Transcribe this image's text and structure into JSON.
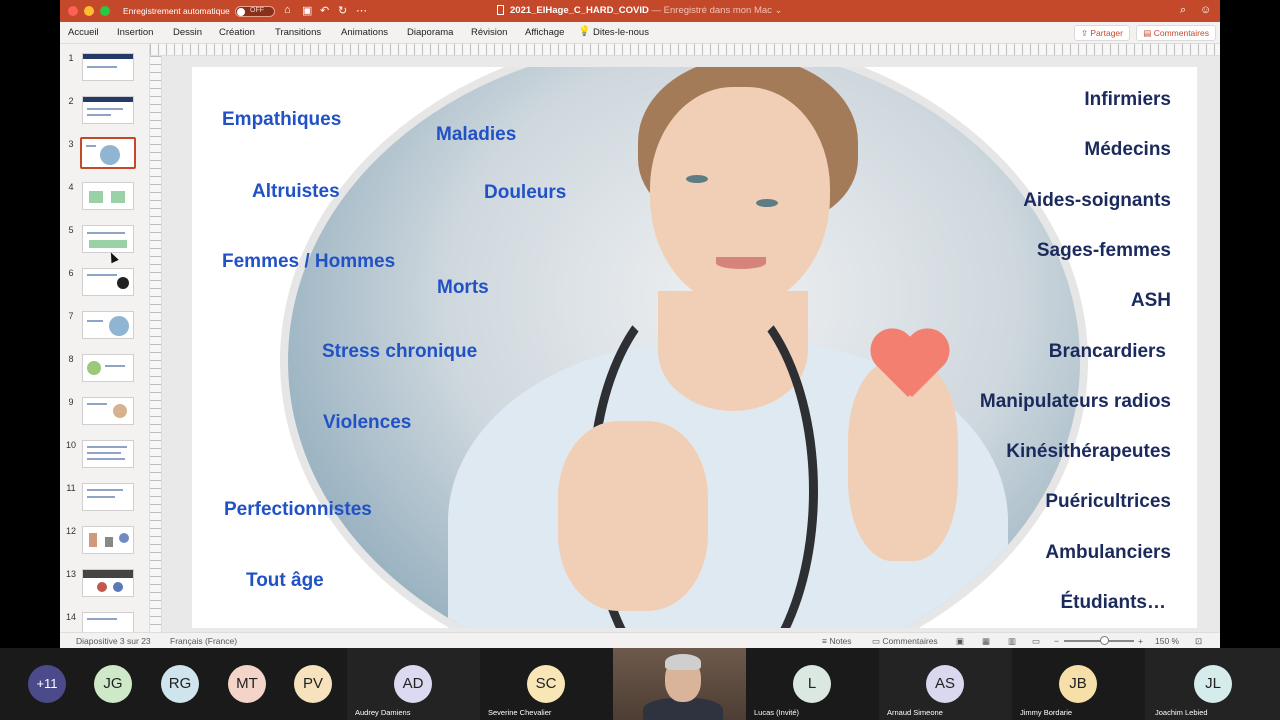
{
  "window": {
    "autosave_label": "Enregistrement automatique",
    "autosave_state": "OFF",
    "document_name": "2021_ElHage_C_HARD_COVID",
    "save_status": "— Enregistré dans mon Mac ⌄"
  },
  "ribbon": {
    "tabs": [
      "Accueil",
      "Insertion",
      "Dessin",
      "Création",
      "Transitions",
      "Animations",
      "Diaporama",
      "Révision",
      "Affichage"
    ],
    "tell_me": "Dites-le-nous",
    "share": "Partager",
    "comments": "Commentaires"
  },
  "thumbnails": {
    "numbers": [
      "1",
      "2",
      "3",
      "4",
      "5",
      "6",
      "7",
      "8",
      "9",
      "10",
      "11",
      "12",
      "13",
      "14"
    ],
    "active_index": 3
  },
  "slide": {
    "left_words": [
      "Empathiques",
      "Maladies",
      "Altruistes",
      "Douleurs",
      "Femmes / Hommes",
      "Morts",
      "Stress chronique",
      "Violences",
      "Perfectionnistes",
      "Tout âge"
    ],
    "right_words": [
      "Infirmiers",
      "Médecins",
      "Aides-soignants",
      "Sages-femmes",
      "ASH",
      "Brancardiers",
      "Manipulateurs radios",
      "Kinésithérapeutes",
      "Puéricultrices",
      "Ambulanciers",
      "Étudiants…"
    ],
    "colors": {
      "left": "#2152c5",
      "right": "#1b2a5c",
      "heart": "#f27f6f"
    }
  },
  "statusbar": {
    "slide_position": "Diapositive 3 sur 23",
    "language": "Français (France)",
    "notes": "Notes",
    "comments": "Commentaires",
    "zoom": "150 %"
  },
  "meeting": {
    "more_count": "+11",
    "participants": [
      {
        "initials": "JG",
        "name": "",
        "color": "#cfe8c8"
      },
      {
        "initials": "RG",
        "name": "",
        "color": "#cfe4ec"
      },
      {
        "initials": "MT",
        "name": "",
        "color": "#f4d3c8"
      },
      {
        "initials": "PV",
        "name": "",
        "color": "#f6e3bd"
      },
      {
        "initials": "AD",
        "name": "Audrey Damiens",
        "color": "#dcdaf0"
      },
      {
        "initials": "SC",
        "name": "Severine Chevalier",
        "color": "#f8e6b7"
      },
      {
        "initials": "L",
        "name": "Lucas (Invité)",
        "color": "#dbe8e2"
      },
      {
        "initials": "AS",
        "name": "Arnaud Simeone",
        "color": "#dad8ef"
      },
      {
        "initials": "JB",
        "name": "Jimmy Bordarie",
        "color": "#f6dfa8"
      },
      {
        "initials": "JL",
        "name": "Joachim Lebied",
        "color": "#d6ecec"
      }
    ]
  },
  "icons": [
    "home-icon",
    "save-icon",
    "undo-icon",
    "redo-icon",
    "more-icon",
    "search-icon",
    "smiley-icon",
    "lightbulb-icon",
    "share-icon",
    "comment-icon",
    "notes-icon",
    "fit-icon"
  ]
}
